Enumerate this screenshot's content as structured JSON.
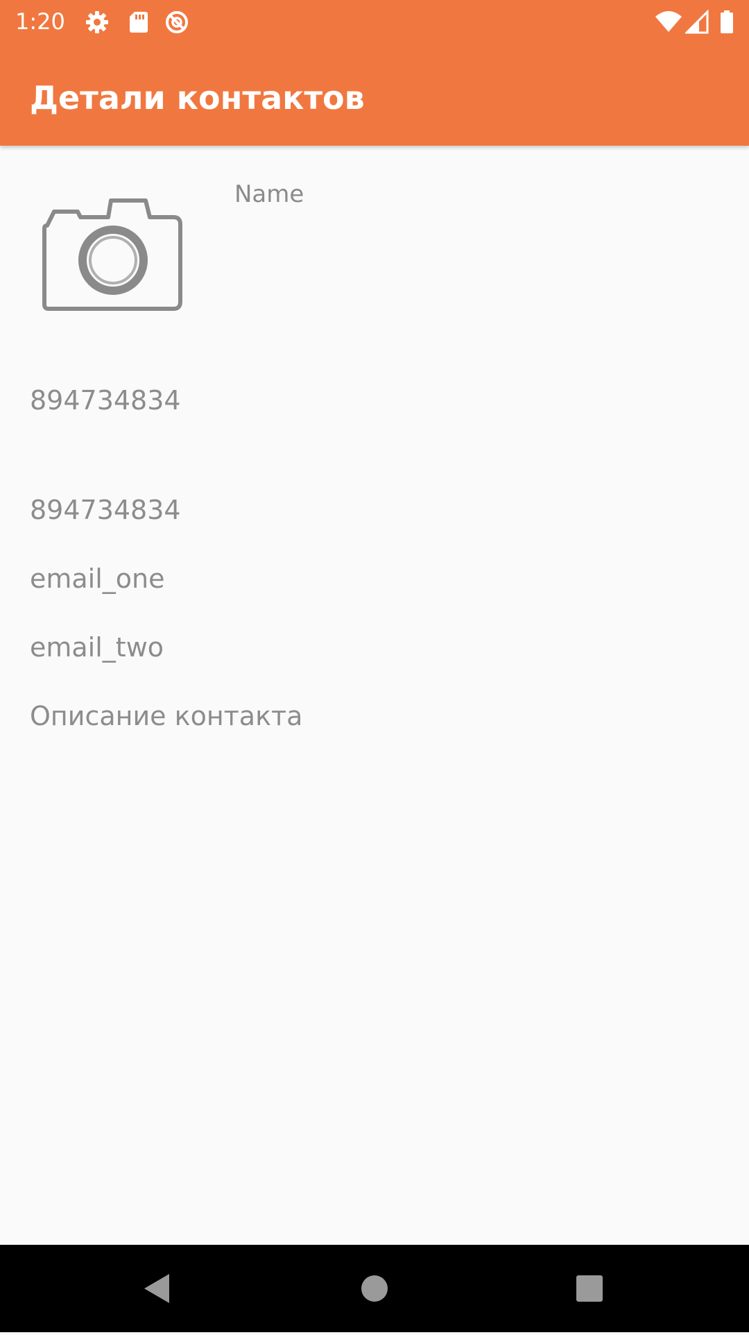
{
  "status_bar": {
    "time": "1:20",
    "left_icons": [
      "gear-icon",
      "sd-card-icon",
      "do-not-disturb-icon"
    ],
    "right_icons": [
      "wifi-icon",
      "cell-signal-icon",
      "battery-icon"
    ],
    "color": "#f07840"
  },
  "app_bar": {
    "title": "Детали контактов"
  },
  "contact": {
    "photo_icon": "camera-icon",
    "name": "Name",
    "phone_one": "894734834",
    "phone_two": "894734834",
    "email_one": "email_one",
    "email_two": "email_two",
    "description": "Описание контакта"
  },
  "nav_bar": {
    "buttons": [
      "back-icon",
      "home-icon",
      "recents-icon"
    ]
  }
}
